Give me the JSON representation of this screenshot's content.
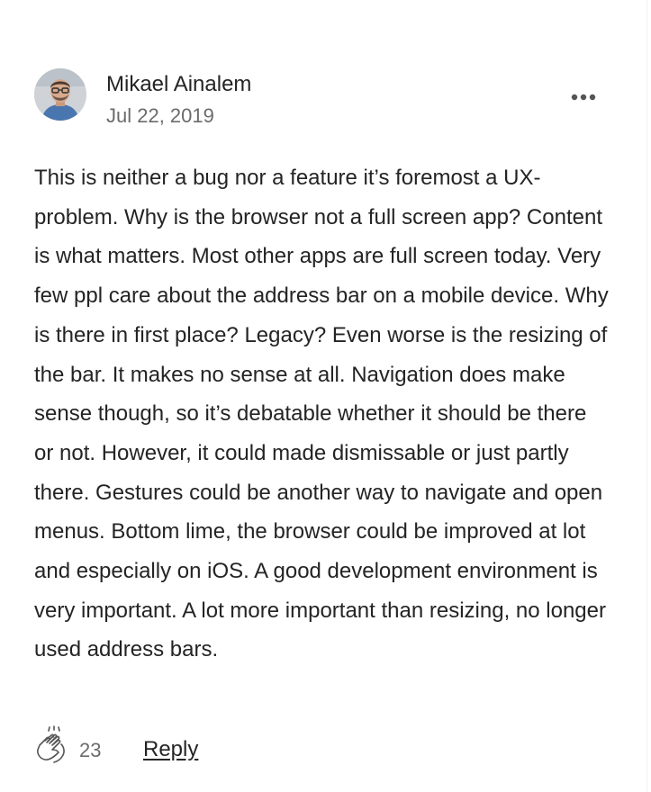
{
  "comment": {
    "author": {
      "name": "Mikael Ainalem",
      "avatar_icon": "person-avatar"
    },
    "date": "Jul 22, 2019",
    "more_icon": "more-horizontal-icon",
    "body": "This is neither a bug nor a feature it’s foremost a UX-problem. Why is the browser not a full screen app? Content is what matters. Most other apps are full screen today. Very few ppl care about the address bar on a mobile device. Why is there in first place? Legacy? Even worse is the resizing of the bar. It makes no sense at all. Navigation does make sense though, so it’s debatable whether it should be there or not. However, it could made dismissable or just partly there. Gestures could be another way to navigate and open menus. Bottom lime, the browser could be improved at lot and especially on iOS. A good development environment is very important. A lot more important than resizing, no longer used address bars.",
    "footer": {
      "clap_icon": "clap-icon",
      "clap_count": "23",
      "reply_label": "Reply"
    }
  },
  "colors": {
    "text_primary": "#242424",
    "text_secondary": "#6b6b6b",
    "background": "#ffffff"
  }
}
